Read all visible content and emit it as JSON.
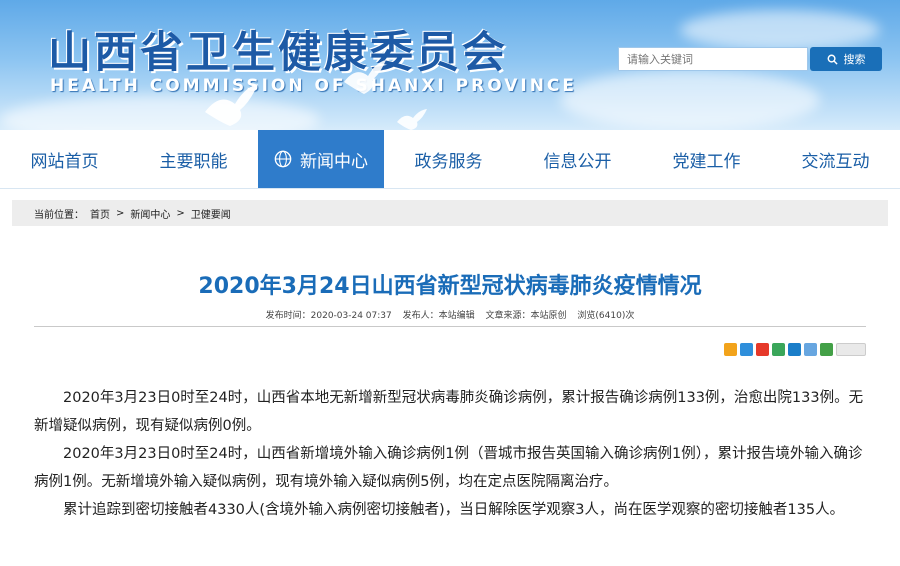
{
  "header": {
    "title": "山西省卫生健康委员会",
    "subtitle": "HEALTH COMMISSION OF SHANXI PROVINCE"
  },
  "search": {
    "placeholder": "请输入关键词",
    "button_label": "搜索"
  },
  "nav": {
    "items": [
      {
        "label": "网站首页"
      },
      {
        "label": "主要职能"
      },
      {
        "label": "新闻中心"
      },
      {
        "label": "政务服务"
      },
      {
        "label": "信息公开"
      },
      {
        "label": "党建工作"
      },
      {
        "label": "交流互动"
      }
    ],
    "active_index": 2
  },
  "breadcrumb": {
    "prefix": "当前位置：",
    "items": [
      "首页",
      "新闻中心",
      "卫健要闻"
    ],
    "separator": ">"
  },
  "article": {
    "title": "2020年3月24日山西省新型冠状病毒肺炎疫情情况",
    "meta": {
      "date": "发布时间：2020-03-24 07:37",
      "source": "发布人：本站编辑",
      "origin": "文章来源：本站原创",
      "views": "浏览(6410)次"
    },
    "paragraphs": [
      "2020年3月23日0时至24时，山西省本地无新增新型冠状病毒肺炎确诊病例，累计报告确诊病例133例，治愈出院133例。无新增疑似病例，现有疑似病例0例。",
      "2020年3月23日0时至24时，山西省新增境外输入确诊病例1例（晋城市报告英国输入确诊病例1例），累计报告境外输入确诊病例1例。无新增境外输入疑似病例，现有境外输入疑似病例5例，均在定点医院隔离治疗。",
      "累计追踪到密切接触者4330人(含境外输入病例密切接触者)，当日解除医学观察3人，尚在医学观察的密切接触者135人。"
    ]
  },
  "share_icons": [
    "qzone-icon",
    "weibo-icon",
    "tencent-weibo-icon",
    "wechat-icon",
    "renren-icon",
    "kaixin-icon",
    "douban-icon",
    "more-share-icon"
  ],
  "colors": {
    "brand_blue": "#1a6cb8",
    "nav_active": "#2f7ccb",
    "header_sky": "#5fa9e8"
  }
}
